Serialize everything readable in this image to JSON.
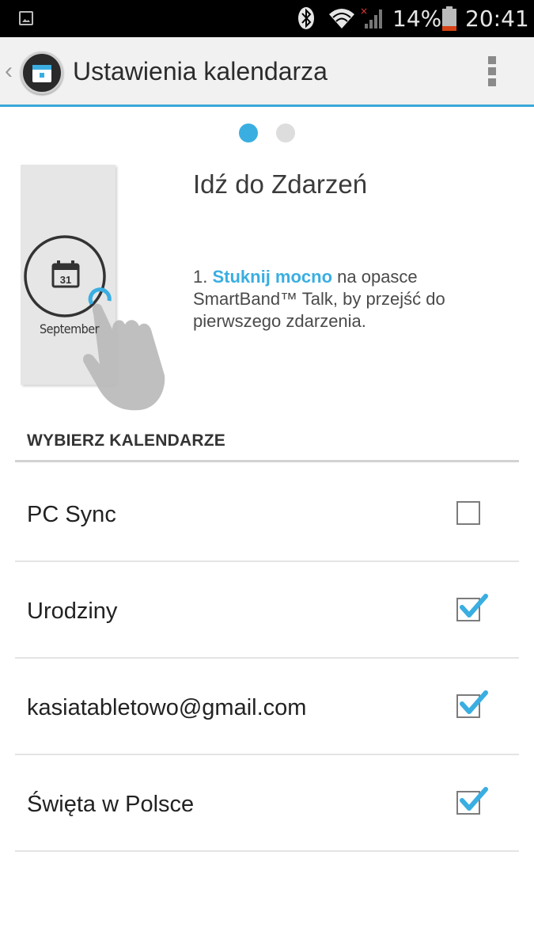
{
  "status_bar": {
    "battery_percent": "14%",
    "time": "20:41",
    "icons": [
      "image-notification-icon",
      "bluetooth-icon",
      "wifi-icon",
      "signal-icon",
      "battery-icon"
    ]
  },
  "action_bar": {
    "title": "Ustawienia kalendarza",
    "back_glyph": "‹",
    "accent_color": "#3aa8d8"
  },
  "pager": {
    "active_index": 0,
    "count": 2
  },
  "instruction": {
    "title": "Idź do Zdarzeń",
    "step_prefix": "1. ",
    "step_highlight": "Stuknij mocno",
    "step_rest": " na opasce SmartBand™ Talk, by przejść do pierwszego zdarzenia.",
    "illustration_day": "31",
    "illustration_month": "September",
    "highlight_color": "#3aaee1"
  },
  "section": {
    "header": "WYBIERZ KALENDARZE"
  },
  "calendars": [
    {
      "label": "PC Sync",
      "checked": false
    },
    {
      "label": "Urodziny",
      "checked": true
    },
    {
      "label": "kasiatabletowo@gmail.com",
      "checked": true
    },
    {
      "label": "Święta w Polsce",
      "checked": true
    }
  ]
}
